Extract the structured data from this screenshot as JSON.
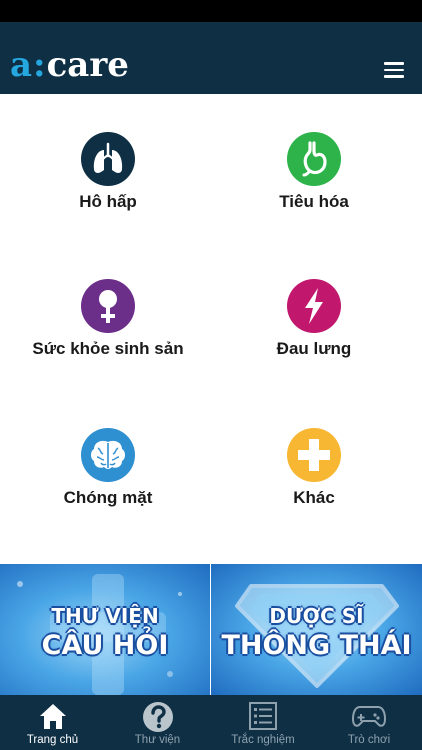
{
  "header": {
    "logo_a": "a",
    "logo_colon": ":",
    "logo_care": "care",
    "menu_icon": "hamburger-icon"
  },
  "categories": [
    {
      "label": "Hô hấp",
      "icon": "lungs-icon",
      "color": "#0f2f45"
    },
    {
      "label": "Tiêu hóa",
      "icon": "stomach-icon",
      "color": "#2db34a"
    },
    {
      "label": "Sức khỏe sinh sản",
      "icon": "female-symbol-icon",
      "color": "#6b2f8a"
    },
    {
      "label": "Đau lưng",
      "icon": "lightning-icon",
      "color": "#c1186e"
    },
    {
      "label": "Chóng mặt",
      "icon": "brain-icon",
      "color": "#2e8fd1"
    },
    {
      "label": "Khác",
      "icon": "plus-cross-icon",
      "color": "#f7b733"
    }
  ],
  "banners": [
    {
      "line1": "THƯ VIỆN",
      "line2": "CÂU HỎI"
    },
    {
      "line1": "DƯỢC SĨ",
      "line2": "THÔNG THÁI"
    }
  ],
  "bottom_nav": [
    {
      "label": "Trang chủ",
      "icon": "home-icon",
      "active": true
    },
    {
      "label": "Thư viện",
      "icon": "question-icon",
      "active": false
    },
    {
      "label": "Trắc nghiệm",
      "icon": "list-icon",
      "active": false
    },
    {
      "label": "Trò chơi",
      "icon": "gamepad-icon",
      "active": false
    }
  ]
}
